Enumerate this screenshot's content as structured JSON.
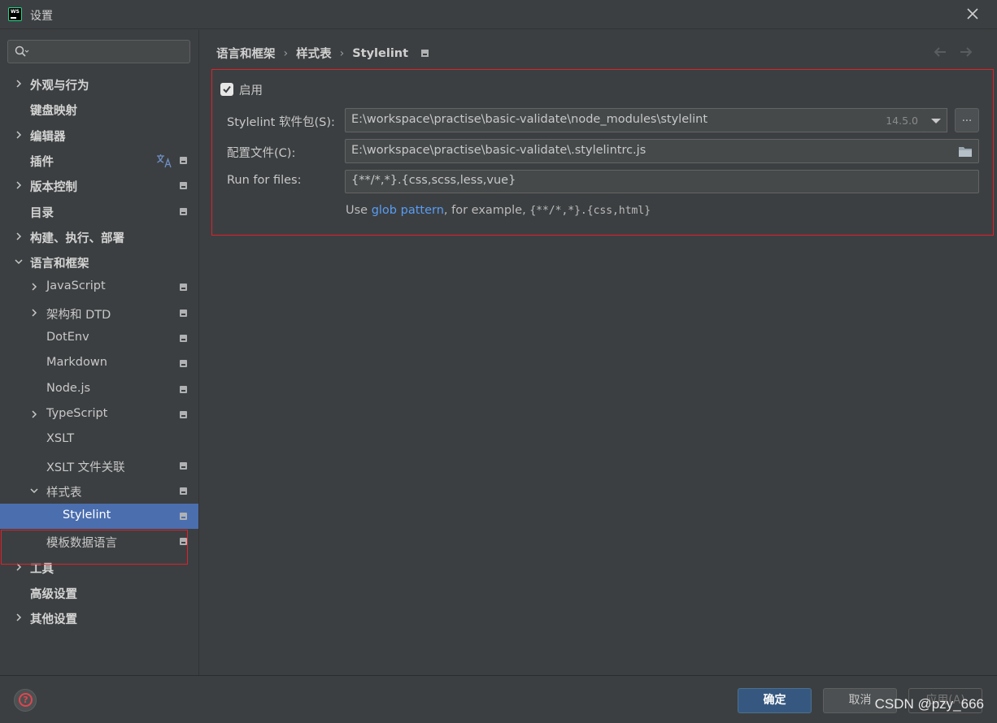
{
  "window": {
    "title": "设置",
    "app_icon_text": "WS"
  },
  "search": {
    "placeholder": "",
    "value": ""
  },
  "sidebar": {
    "items": [
      {
        "label": "外观与行为",
        "expandable": true,
        "expanded": false,
        "level": 0,
        "project_icon": false
      },
      {
        "label": "键盘映射",
        "expandable": false,
        "level": 0,
        "project_icon": false
      },
      {
        "label": "编辑器",
        "expandable": true,
        "expanded": false,
        "level": 0,
        "project_icon": false
      },
      {
        "label": "插件",
        "expandable": false,
        "level": 0,
        "project_icon": true,
        "translate_icon": true
      },
      {
        "label": "版本控制",
        "expandable": true,
        "expanded": false,
        "level": 0,
        "project_icon": true
      },
      {
        "label": "目录",
        "expandable": false,
        "level": 0,
        "project_icon": true
      },
      {
        "label": "构建、执行、部署",
        "expandable": true,
        "expanded": false,
        "level": 0,
        "project_icon": false
      },
      {
        "label": "语言和框架",
        "expandable": true,
        "expanded": true,
        "level": 0,
        "project_icon": false
      },
      {
        "label": "JavaScript",
        "expandable": true,
        "expanded": false,
        "level": 1,
        "project_icon": true
      },
      {
        "label": "架构和 DTD",
        "expandable": true,
        "expanded": false,
        "level": 1,
        "project_icon": true
      },
      {
        "label": "DotEnv",
        "expandable": false,
        "level": 1,
        "project_icon": true
      },
      {
        "label": "Markdown",
        "expandable": false,
        "level": 1,
        "project_icon": true
      },
      {
        "label": "Node.js",
        "expandable": false,
        "level": 1,
        "project_icon": true
      },
      {
        "label": "TypeScript",
        "expandable": true,
        "expanded": false,
        "level": 1,
        "project_icon": true
      },
      {
        "label": "XSLT",
        "expandable": false,
        "level": 1,
        "project_icon": false
      },
      {
        "label": "XSLT 文件关联",
        "expandable": false,
        "level": 1,
        "project_icon": true
      },
      {
        "label": "样式表",
        "expandable": true,
        "expanded": true,
        "level": 1,
        "project_icon": true
      },
      {
        "label": "Stylelint",
        "expandable": false,
        "level": 2,
        "project_icon": true,
        "selected": true
      },
      {
        "label": "模板数据语言",
        "expandable": false,
        "level": 1,
        "project_icon": true
      },
      {
        "label": "工具",
        "expandable": true,
        "expanded": false,
        "level": 0,
        "project_icon": false
      },
      {
        "label": "高级设置",
        "expandable": false,
        "level": 0,
        "project_icon": false
      },
      {
        "label": "其他设置",
        "expandable": true,
        "expanded": false,
        "level": 0,
        "project_icon": false
      }
    ]
  },
  "breadcrumb": {
    "items": [
      "语言和框架",
      "样式表",
      "Stylelint"
    ],
    "separator": "›"
  },
  "form": {
    "enable_label": "启用",
    "enabled": true,
    "package_label": "Stylelint 软件包(S):",
    "package_value": "E:\\workspace\\practise\\basic-validate\\node_modules\\stylelint",
    "package_version": "14.5.0",
    "more_button": "...",
    "config_label": "配置文件(C):",
    "config_value": "E:\\workspace\\practise\\basic-validate\\.stylelintrc.js",
    "files_label": "Run for files:",
    "files_value": "{**/*,*}.{css,scss,less,vue}",
    "hint_prefix": "Use ",
    "hint_link": "glob pattern",
    "hint_middle": ", for example, ",
    "hint_example": "{**/*,*}.{css,html}"
  },
  "footer": {
    "ok_label": "确定",
    "cancel_label": "取消",
    "apply_label": "应用(A)",
    "watermark": "CSDN @pzy_666"
  },
  "colors": {
    "background": "#3c3f41",
    "selection": "#4b6eaf",
    "highlight_border": "#e0202a",
    "link": "#589df6",
    "ok_button": "#365880"
  }
}
